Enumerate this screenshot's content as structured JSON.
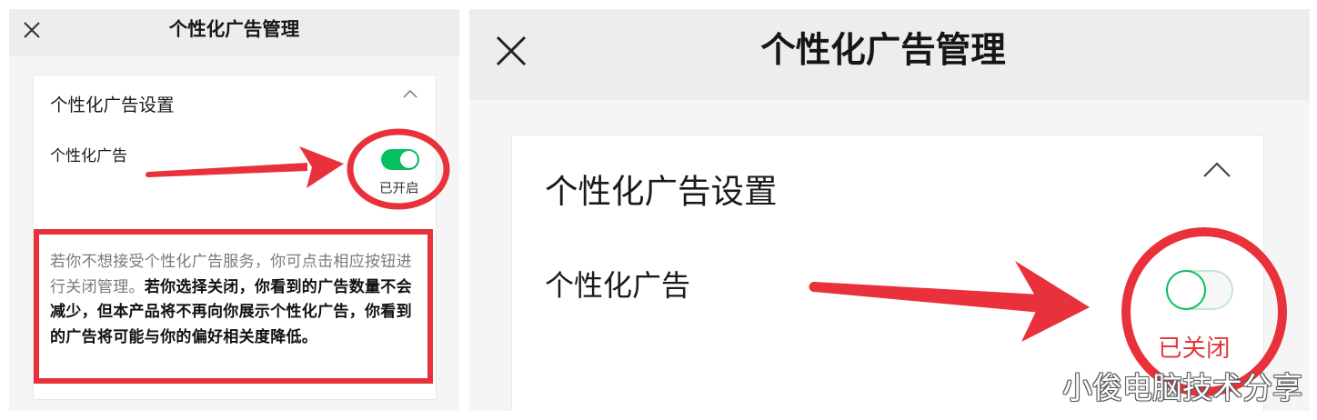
{
  "left_panel": {
    "header": {
      "title": "个性化广告管理",
      "close_icon": "close-icon"
    },
    "settings_card": {
      "section_title": "个性化广告设置",
      "collapse_icon": "chevron-up-icon",
      "ad_toggle": {
        "label": "个性化广告",
        "enabled": true,
        "status_text": "已开启"
      },
      "description": {
        "normal_text": "若你不想接受个性化广告服务，你可点击相应按钮进行关闭管理。",
        "bold_text": "若你选择关闭，你看到的广告数量不会减少，但本产品将不再向你展示个性化广告，你看到的广告将可能与你的偏好相关度降低。"
      }
    }
  },
  "right_panel": {
    "header": {
      "title": "个性化广告管理",
      "close_icon": "close-icon"
    },
    "settings_card": {
      "section_title": "个性化广告设置",
      "collapse_icon": "chevron-up-icon",
      "ad_toggle": {
        "label": "个性化广告",
        "enabled": false,
        "status_text": "已关闭"
      }
    }
  },
  "watermark": "小俊电脑技术分享",
  "colors": {
    "toggle_on": "#07c160",
    "annotation_red": "#e8313a",
    "status_off_text": "#e23a3a",
    "header_bg": "#ededed",
    "page_bg": "#f5f5f5"
  }
}
